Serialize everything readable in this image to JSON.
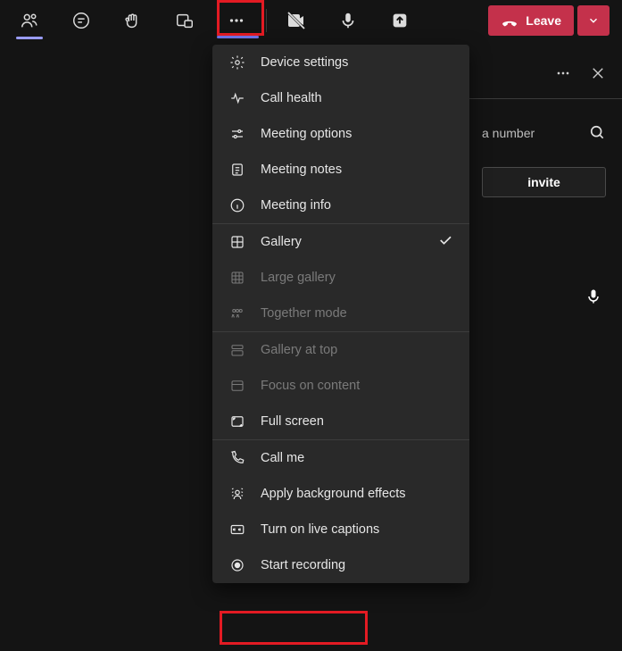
{
  "toolbar": {
    "leave_label": "Leave"
  },
  "panel": {
    "search_placeholder": "a number",
    "share_invite_label": "invite"
  },
  "menu": {
    "device_settings": "Device settings",
    "call_health": "Call health",
    "meeting_options": "Meeting options",
    "meeting_notes": "Meeting notes",
    "meeting_info": "Meeting info",
    "gallery": "Gallery",
    "large_gallery": "Large gallery",
    "together_mode": "Together mode",
    "gallery_at_top": "Gallery at top",
    "focus_on_content": "Focus on content",
    "full_screen": "Full screen",
    "call_me": "Call me",
    "apply_bg": "Apply background effects",
    "live_captions": "Turn on live captions",
    "start_recording": "Start recording"
  }
}
